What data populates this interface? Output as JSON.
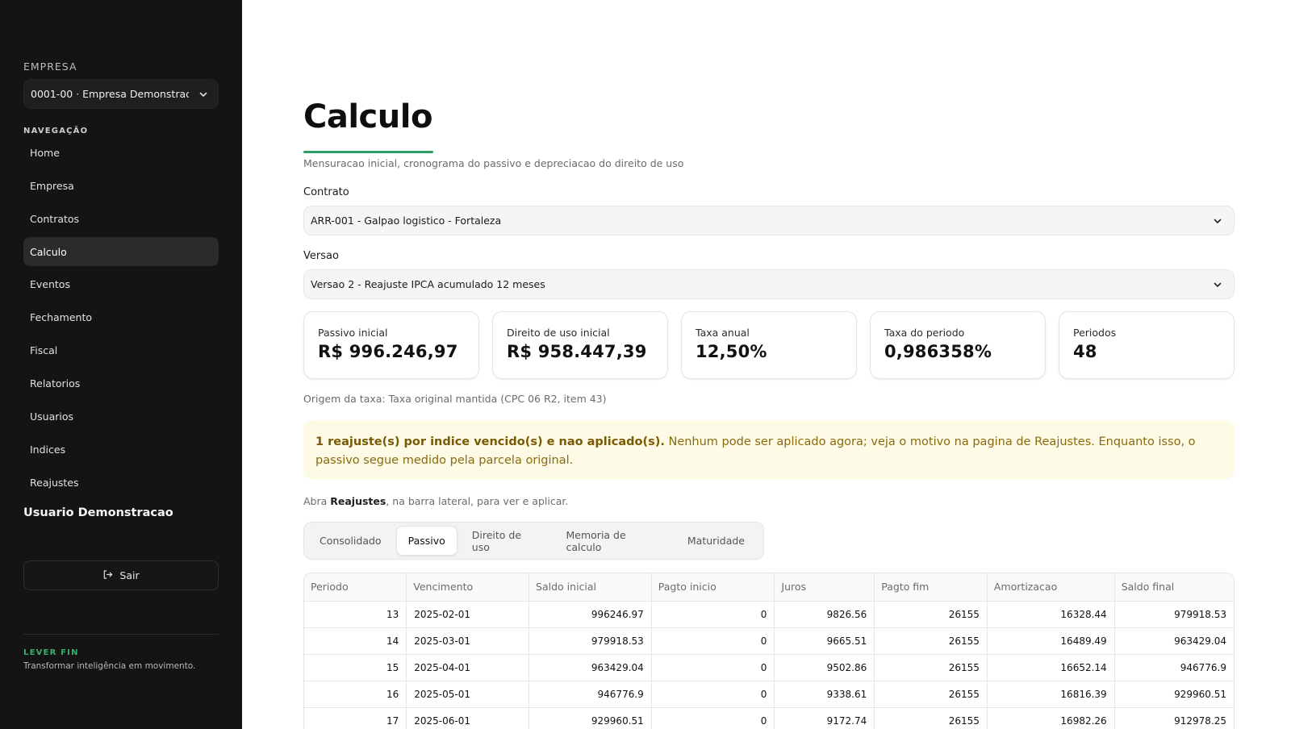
{
  "sidebar": {
    "company_label": "EMPRESA",
    "company_value": "0001-00 · Empresa Demonstracao",
    "nav_label": "NAVEGAÇÃO",
    "nav_items": [
      "Home",
      "Empresa",
      "Contratos",
      "Calculo",
      "Eventos",
      "Fechamento",
      "Fiscal",
      "Relatorios",
      "Usuarios",
      "Indices",
      "Reajustes"
    ],
    "active_item": "Calculo",
    "user_name": "Usuario Demonstracao",
    "logout_label": "Sair",
    "brand": "LEVER FIN",
    "tagline": "Transformar inteligência em movimento."
  },
  "page": {
    "title": "Calculo",
    "subtitle": "Mensuracao inicial, cronograma do passivo e depreciacao do direito de uso",
    "contract_label": "Contrato",
    "contract_value": "ARR-001 - Galpao logistico - Fortaleza",
    "version_label": "Versao",
    "version_value": "Versao 2 - Reajuste IPCA acumulado 12 meses",
    "origin_text": "Origem da taxa: Taxa original mantida (CPC 06 R2, item 43)"
  },
  "cards": [
    {
      "label": "Passivo inicial",
      "value": "R$ 996.246,97"
    },
    {
      "label": "Direito de uso inicial",
      "value": "R$ 958.447,39"
    },
    {
      "label": "Taxa anual",
      "value": "12,50%"
    },
    {
      "label": "Taxa do periodo",
      "value": "0,986358%"
    },
    {
      "label": "Periodos",
      "value": "48"
    }
  ],
  "alert": {
    "bold": "1 reajuste(s) por indice vencido(s) e nao aplicado(s).",
    "text": " Nenhum pode ser aplicado agora; veja o motivo na pagina de Reajustes. Enquanto isso, o passivo segue medido pela parcela original."
  },
  "hint": {
    "before": "Abra ",
    "bold": "Reajustes",
    "after": ", na barra lateral, para ver e aplicar."
  },
  "tabs": [
    "Consolidado",
    "Passivo",
    "Direito de uso",
    "Memoria de calculo",
    "Maturidade"
  ],
  "active_tab": "Passivo",
  "table": {
    "headers": [
      "Periodo",
      "Vencimento",
      "Saldo inicial",
      "Pagto inicio",
      "Juros",
      "Pagto fim",
      "Amortizacao",
      "Saldo final"
    ],
    "rows": [
      [
        "13",
        "2025-02-01",
        "996246.97",
        "0",
        "9826.56",
        "26155",
        "16328.44",
        "979918.53"
      ],
      [
        "14",
        "2025-03-01",
        "979918.53",
        "0",
        "9665.51",
        "26155",
        "16489.49",
        "963429.04"
      ],
      [
        "15",
        "2025-04-01",
        "963429.04",
        "0",
        "9502.86",
        "26155",
        "16652.14",
        "946776.9"
      ],
      [
        "16",
        "2025-05-01",
        "946776.9",
        "0",
        "9338.61",
        "26155",
        "16816.39",
        "929960.51"
      ],
      [
        "17",
        "2025-06-01",
        "929960.51",
        "0",
        "9172.74",
        "26155",
        "16982.26",
        "912978.25"
      ]
    ]
  }
}
